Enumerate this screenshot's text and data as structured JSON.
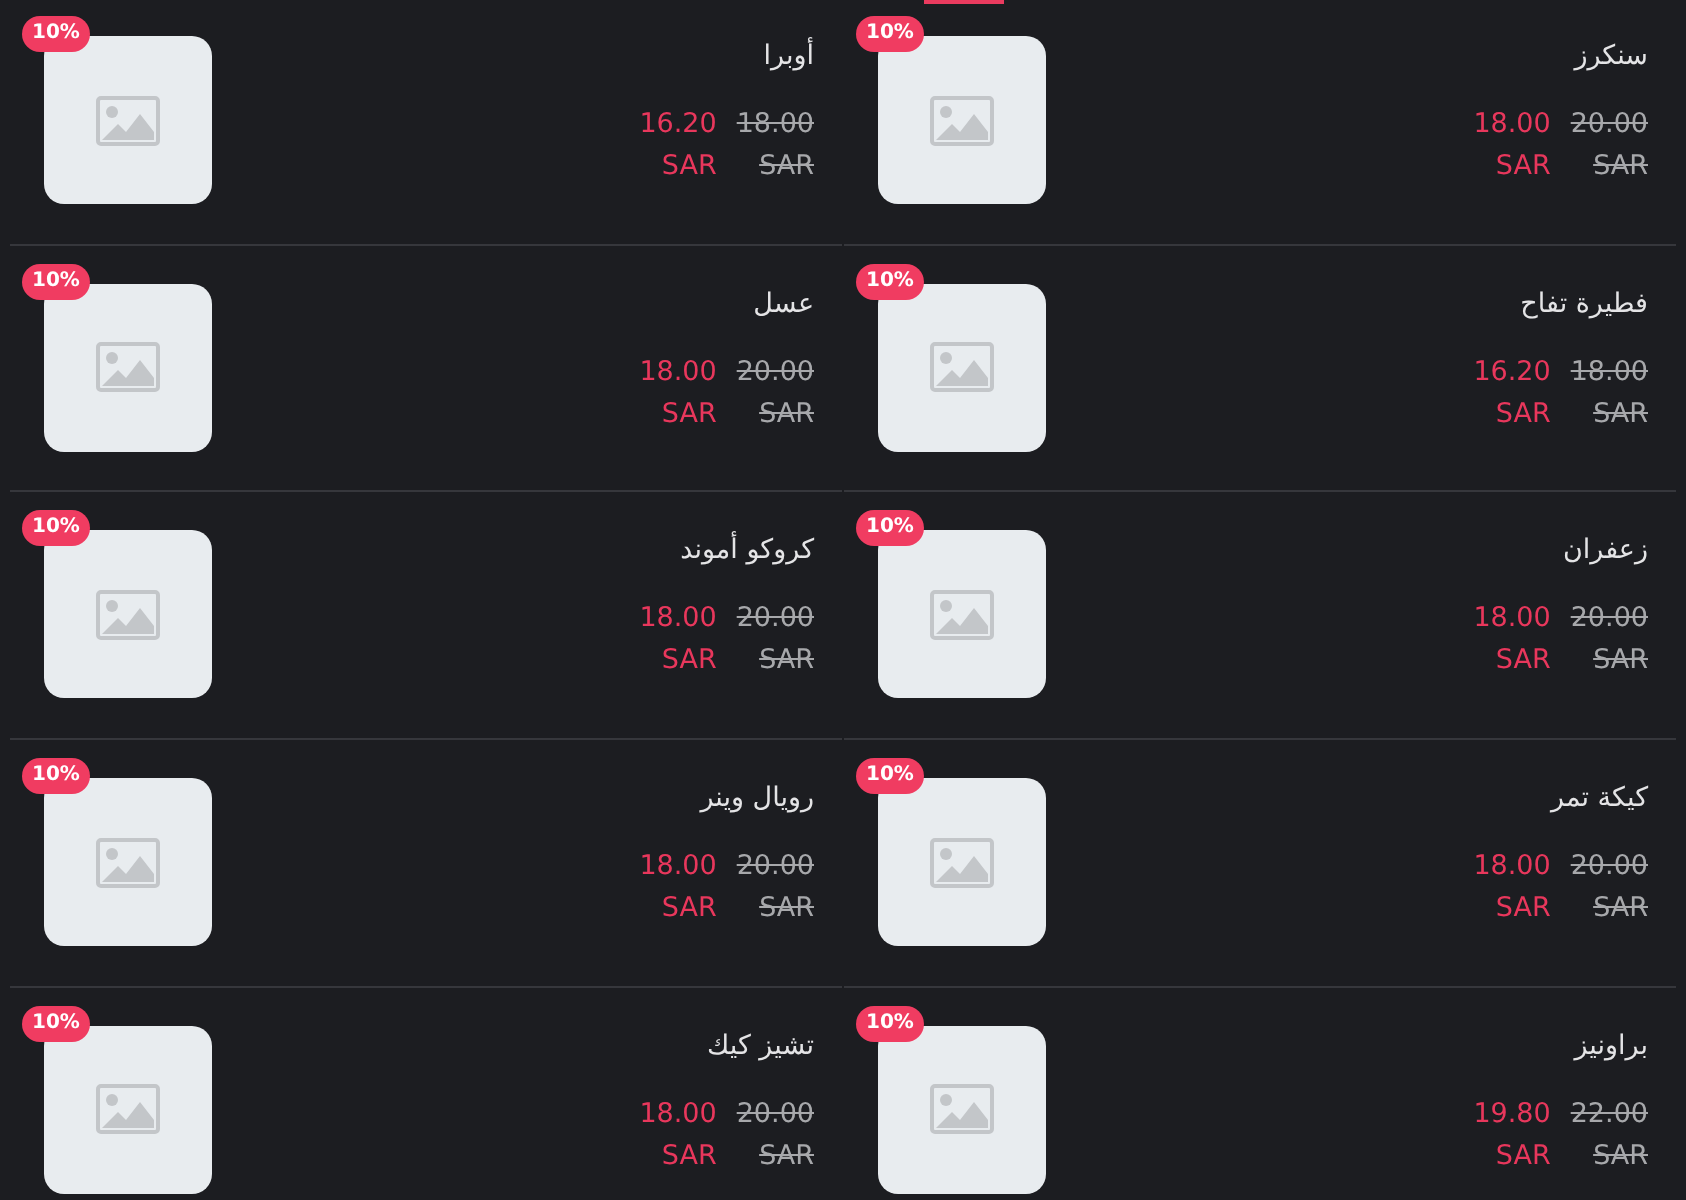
{
  "products": [
    {
      "name": "أوبرا",
      "discount": "10%",
      "old_price": "18.00",
      "old_currency": "SAR",
      "price": "16.20",
      "currency": "SAR"
    },
    {
      "name": "عسل",
      "discount": "10%",
      "old_price": "20.00",
      "old_currency": "SAR",
      "price": "18.00",
      "currency": "SAR"
    },
    {
      "name": "كروكو أموند",
      "discount": "10%",
      "old_price": "20.00",
      "old_currency": "SAR",
      "price": "18.00",
      "currency": "SAR"
    },
    {
      "name": "رويال وينر",
      "discount": "10%",
      "old_price": "20.00",
      "old_currency": "SAR",
      "price": "18.00",
      "currency": "SAR"
    },
    {
      "name": "تشيز كيك",
      "discount": "10%",
      "old_price": "20.00",
      "old_currency": "SAR",
      "price": "18.00",
      "currency": "SAR"
    },
    {
      "name": "سنكرز",
      "discount": "10%",
      "old_price": "20.00",
      "old_currency": "SAR",
      "price": "18.00",
      "currency": "SAR"
    },
    {
      "name": "فطيرة تفاح",
      "discount": "10%",
      "old_price": "18.00",
      "old_currency": "SAR",
      "price": "16.20",
      "currency": "SAR"
    },
    {
      "name": "زعفران",
      "discount": "10%",
      "old_price": "20.00",
      "old_currency": "SAR",
      "price": "18.00",
      "currency": "SAR"
    },
    {
      "name": "كيكة تمر",
      "discount": "10%",
      "old_price": "20.00",
      "old_currency": "SAR",
      "price": "18.00",
      "currency": "SAR"
    },
    {
      "name": "براونيز",
      "discount": "10%",
      "old_price": "22.00",
      "old_currency": "SAR",
      "price": "19.80",
      "currency": "SAR"
    }
  ]
}
